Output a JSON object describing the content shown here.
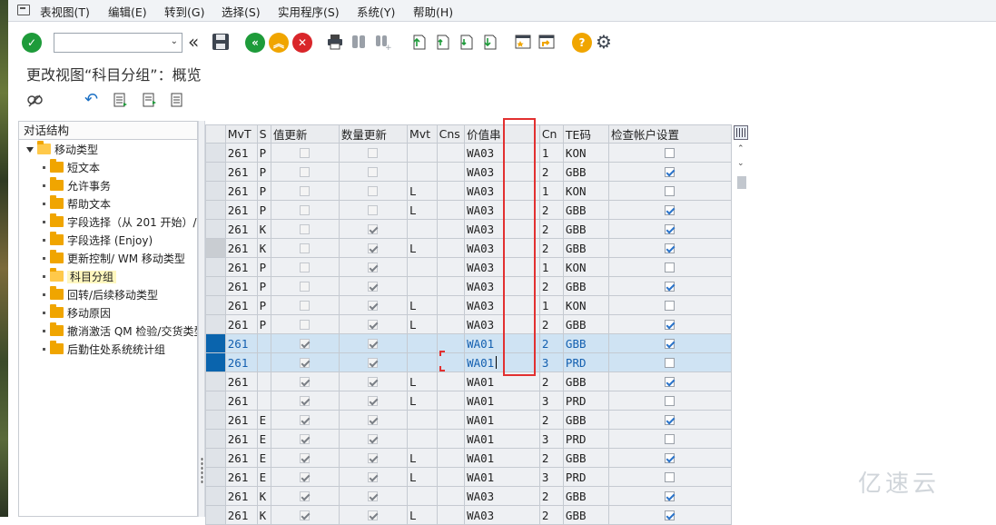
{
  "menu": [
    "表视图(T)",
    "编辑(E)",
    "转到(G)",
    "选择(S)",
    "实用程序(S)",
    "系统(Y)",
    "帮助(H)"
  ],
  "title": "更改视图“科目分组”：概览",
  "tree": {
    "header": "对话结构",
    "root": "移动类型",
    "items": [
      "短文本",
      "允许事务",
      "帮助文本",
      "字段选择（从 201 开始）/",
      "字段选择 (Enjoy)",
      "更新控制/ WM 移动类型",
      "科目分组",
      "回转/后续移动类型",
      "移动原因",
      "撤消激活 QM 检验/交货类型",
      "后勤住处系统统计组"
    ]
  },
  "table": {
    "headers": [
      "MvT",
      "S",
      "值更新",
      "数量更新",
      "Mvt",
      "Cns",
      "价值串",
      "Cn",
      "TE码",
      "检查帐户设置"
    ],
    "rows": [
      {
        "mvt": "261",
        "s": "P",
        "val": false,
        "qty": false,
        "m": "",
        "c": "",
        "vs": "WA03",
        "cn": "1",
        "te": "KON",
        "chk": false
      },
      {
        "mvt": "261",
        "s": "P",
        "val": false,
        "qty": false,
        "m": "",
        "c": "",
        "vs": "WA03",
        "cn": "2",
        "te": "GBB",
        "chk": true
      },
      {
        "mvt": "261",
        "s": "P",
        "val": false,
        "qty": false,
        "m": "L",
        "c": "",
        "vs": "WA03",
        "cn": "1",
        "te": "KON",
        "chk": false
      },
      {
        "mvt": "261",
        "s": "P",
        "val": false,
        "qty": false,
        "m": "L",
        "c": "",
        "vs": "WA03",
        "cn": "2",
        "te": "GBB",
        "chk": true
      },
      {
        "mvt": "261",
        "s": "K",
        "val": false,
        "qty": true,
        "m": "",
        "c": "",
        "vs": "WA03",
        "cn": "2",
        "te": "GBB",
        "chk": true
      },
      {
        "mvt": "261",
        "s": "K",
        "val": false,
        "qty": true,
        "m": "L",
        "c": "",
        "vs": "WA03",
        "cn": "2",
        "te": "GBB",
        "chk": true
      },
      {
        "mvt": "261",
        "s": "P",
        "val": false,
        "qty": true,
        "m": "",
        "c": "",
        "vs": "WA03",
        "cn": "1",
        "te": "KON",
        "chk": false
      },
      {
        "mvt": "261",
        "s": "P",
        "val": false,
        "qty": true,
        "m": "",
        "c": "",
        "vs": "WA03",
        "cn": "2",
        "te": "GBB",
        "chk": true
      },
      {
        "mvt": "261",
        "s": "P",
        "val": false,
        "qty": true,
        "m": "L",
        "c": "",
        "vs": "WA03",
        "cn": "1",
        "te": "KON",
        "chk": false
      },
      {
        "mvt": "261",
        "s": "P",
        "val": false,
        "qty": true,
        "m": "L",
        "c": "",
        "vs": "WA03",
        "cn": "2",
        "te": "GBB",
        "chk": true
      },
      {
        "mvt": "261",
        "s": "",
        "val": true,
        "qty": true,
        "m": "",
        "c": "",
        "vs": "WA01",
        "cn": "2",
        "te": "GBB",
        "chk": true
      },
      {
        "mvt": "261",
        "s": "",
        "val": true,
        "qty": true,
        "m": "",
        "c": "",
        "vs": "WA01",
        "cn": "3",
        "te": "PRD",
        "chk": false
      },
      {
        "mvt": "261",
        "s": "",
        "val": true,
        "qty": true,
        "m": "L",
        "c": "",
        "vs": "WA01",
        "cn": "2",
        "te": "GBB",
        "chk": true
      },
      {
        "mvt": "261",
        "s": "",
        "val": true,
        "qty": true,
        "m": "L",
        "c": "",
        "vs": "WA01",
        "cn": "3",
        "te": "PRD",
        "chk": false
      },
      {
        "mvt": "261",
        "s": "E",
        "val": true,
        "qty": true,
        "m": "",
        "c": "",
        "vs": "WA01",
        "cn": "2",
        "te": "GBB",
        "chk": true
      },
      {
        "mvt": "261",
        "s": "E",
        "val": true,
        "qty": true,
        "m": "",
        "c": "",
        "vs": "WA01",
        "cn": "3",
        "te": "PRD",
        "chk": false
      },
      {
        "mvt": "261",
        "s": "E",
        "val": true,
        "qty": true,
        "m": "L",
        "c": "",
        "vs": "WA01",
        "cn": "2",
        "te": "GBB",
        "chk": true
      },
      {
        "mvt": "261",
        "s": "E",
        "val": true,
        "qty": true,
        "m": "L",
        "c": "",
        "vs": "WA01",
        "cn": "3",
        "te": "PRD",
        "chk": false
      },
      {
        "mvt": "261",
        "s": "K",
        "val": true,
        "qty": true,
        "m": "",
        "c": "",
        "vs": "WA03",
        "cn": "2",
        "te": "GBB",
        "chk": true
      },
      {
        "mvt": "261",
        "s": "K",
        "val": true,
        "qty": true,
        "m": "L",
        "c": "",
        "vs": "WA03",
        "cn": "2",
        "te": "GBB",
        "chk": true
      }
    ]
  },
  "colors": {
    "accent": "#0a64ad",
    "highlight": "#e23030",
    "selected_row": "#cfe3f3"
  },
  "watermark": "亿速云"
}
